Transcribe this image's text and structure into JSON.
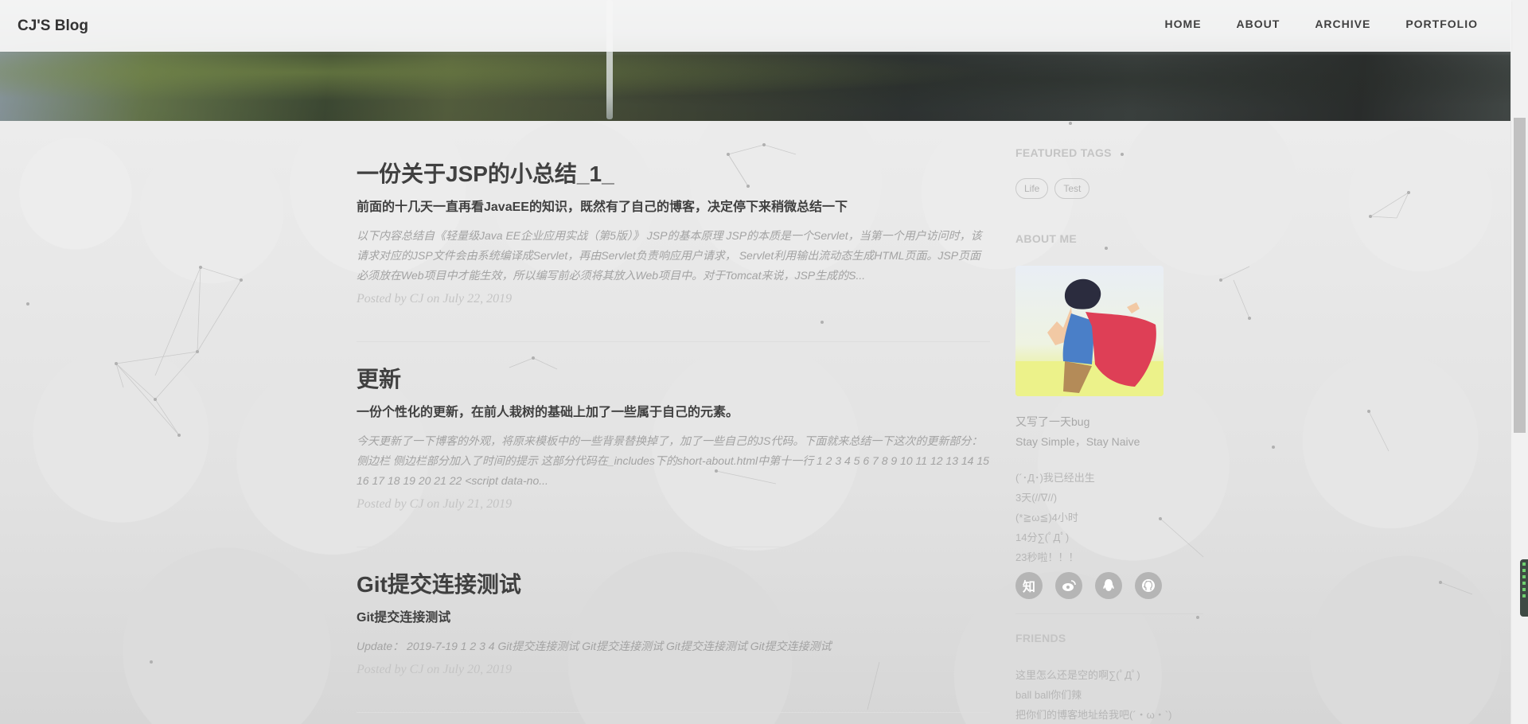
{
  "nav": {
    "brand": "CJ'S Blog",
    "links": [
      "HOME",
      "ABOUT",
      "ARCHIVE",
      "PORTFOLIO"
    ]
  },
  "posts": [
    {
      "title": "一份关于JSP的小总结_1_",
      "subtitle": "前面的十几天一直再看JavaEE的知识，既然有了自己的博客，决定停下来稍微总结一下",
      "excerpt": "以下内容总结自《轻量级Java EE企业应用实战（第5版）》 JSP的基本原理 JSP的本质是一个Servlet，当第一个用户访问时，该请求对应的JSP文件会由系统编译成Servlet，再由Servlet负责响应用户请求， Servlet利用输出流动态生成HTML页面。JSP页面必须放在Web项目中才能生效，所以编写前必须将其放入Web项目中。对于Tomcat来说，JSP生成的S...",
      "meta": "Posted by CJ on July 22, 2019"
    },
    {
      "title": "更新",
      "subtitle": "一份个性化的更新，在前人栽树的基础上加了一些属于自己的元素。",
      "excerpt": "今天更新了一下博客的外观，将原来模板中的一些背景替换掉了，加了一些自己的JS代码。下面就来总结一下这次的更新部分： 侧边栏 侧边栏部分加入了时间的提示 这部分代码在_includes下的short-about.html中第十一行 1 2 3 4 5 6 7 8 9 10 11 12 13 14 15 16 17 18 19 20 21 22 <script data-no...",
      "meta": "Posted by CJ on July 21, 2019"
    },
    {
      "title": "Git提交连接测试",
      "subtitle": "Git提交连接测试",
      "excerpt": "Update： 2019-7-19 1 2 3 4 Git提交连接测试 Git提交连接测试 Git提交连接测试 Git提交连接测试",
      "meta": "Posted by CJ on July 20, 2019"
    }
  ],
  "sidebar": {
    "featured_tags_heading": "FEATURED TAGS",
    "tags": [
      "Life",
      "Test"
    ],
    "about_heading": "ABOUT ME",
    "about_lines": [
      "又写了一天bug",
      "Stay Simple，Stay Naive"
    ],
    "timer_lines": [
      "(´･Д･)我已经出生",
      "3天(//∇//)",
      "(*≧ω≦)4小时",
      "14分∑(ﾟДﾟ)",
      "23秒啦！！！"
    ],
    "socials": [
      {
        "name": "zhihu-icon",
        "glyph": "知"
      },
      {
        "name": "weibo-icon",
        "glyph": "◉"
      },
      {
        "name": "qq-icon",
        "glyph": "●"
      },
      {
        "name": "github-icon",
        "glyph": "◐"
      }
    ],
    "friends_heading": "FRIENDS",
    "friends_lines": [
      "这里怎么还是空的啊∑(ﾟДﾟ)",
      "ball ball你们辣",
      "把你们的博客地址给我吧(´・ω・`)"
    ]
  },
  "colors": {
    "text_dark": "#404040",
    "text_muted": "#a3a3a3",
    "meta": "#c4c4c4"
  }
}
